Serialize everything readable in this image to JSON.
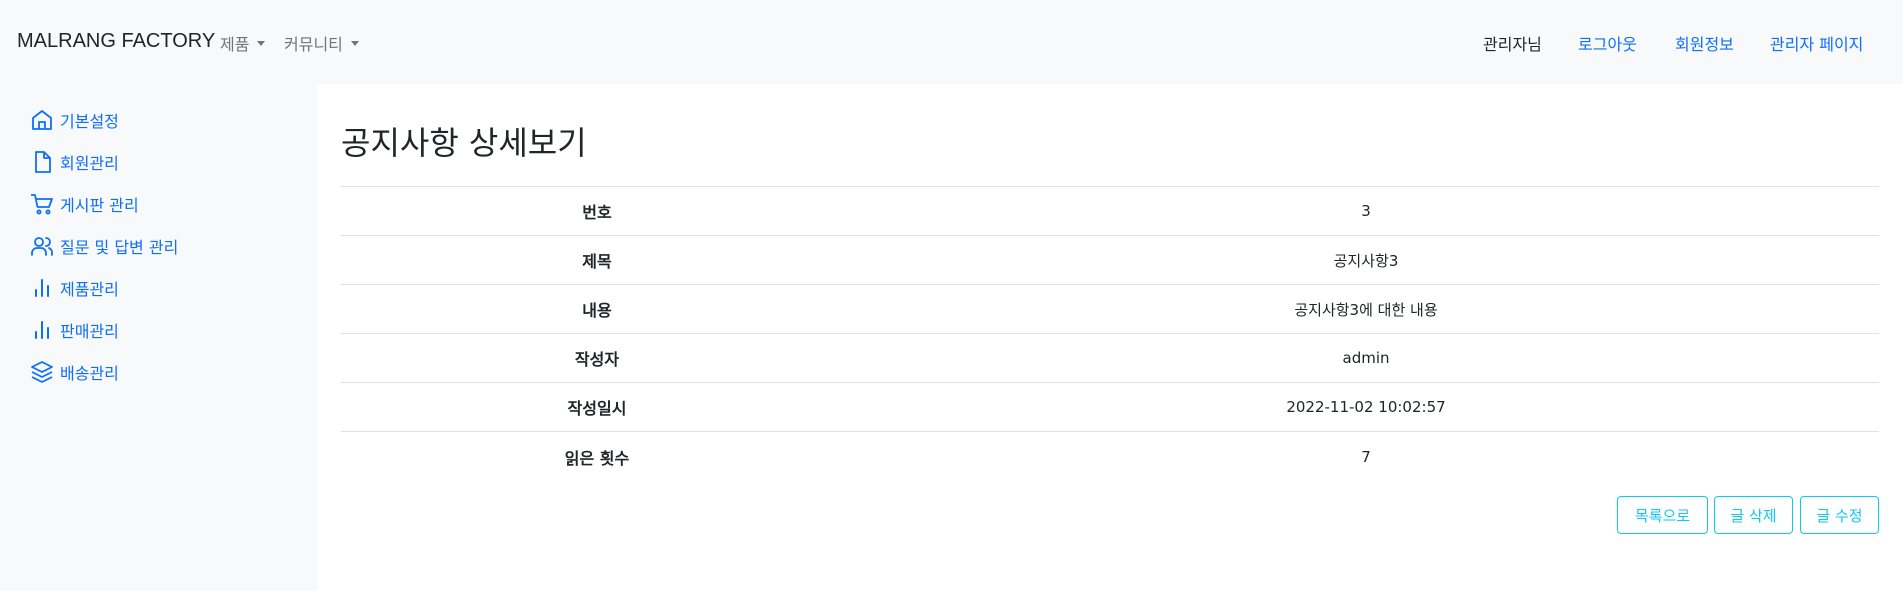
{
  "navbar": {
    "brand": "MALRANG FACTORY",
    "menus": [
      {
        "label": "제품"
      },
      {
        "label": "커뮤니티"
      }
    ],
    "user_greeting": "관리자님",
    "links": {
      "logout": "로그아웃",
      "member_info": "회원정보",
      "admin_page": "관리자 페이지"
    }
  },
  "sidebar": {
    "items": [
      {
        "label": "기본설정",
        "icon": "home-icon"
      },
      {
        "label": "회원관리",
        "icon": "file-icon"
      },
      {
        "label": "게시판 관리",
        "icon": "cart-icon"
      },
      {
        "label": "질문 및 답변 관리",
        "icon": "users-icon"
      },
      {
        "label": "제품관리",
        "icon": "bar-chart-icon"
      },
      {
        "label": "판매관리",
        "icon": "bar-chart-icon"
      },
      {
        "label": "배송관리",
        "icon": "layers-icon"
      }
    ]
  },
  "main": {
    "title": "공지사항 상세보기",
    "rows": [
      {
        "label": "번호",
        "value": "3"
      },
      {
        "label": "제목",
        "value": "공지사항3"
      },
      {
        "label": "내용",
        "value": "공지사항3에 대한 내용"
      },
      {
        "label": "작성자",
        "value": "admin"
      },
      {
        "label": "작성일시",
        "value": "2022-11-02 10:02:57"
      },
      {
        "label": "읽은 횟수",
        "value": "7"
      }
    ],
    "buttons": {
      "list": "목록으로",
      "delete": "글 삭제",
      "edit": "글 수정"
    }
  },
  "colors": {
    "link": "#0d6efd",
    "button_outline": "#0dcaf0",
    "nav_bg": "#f8f9fa"
  }
}
